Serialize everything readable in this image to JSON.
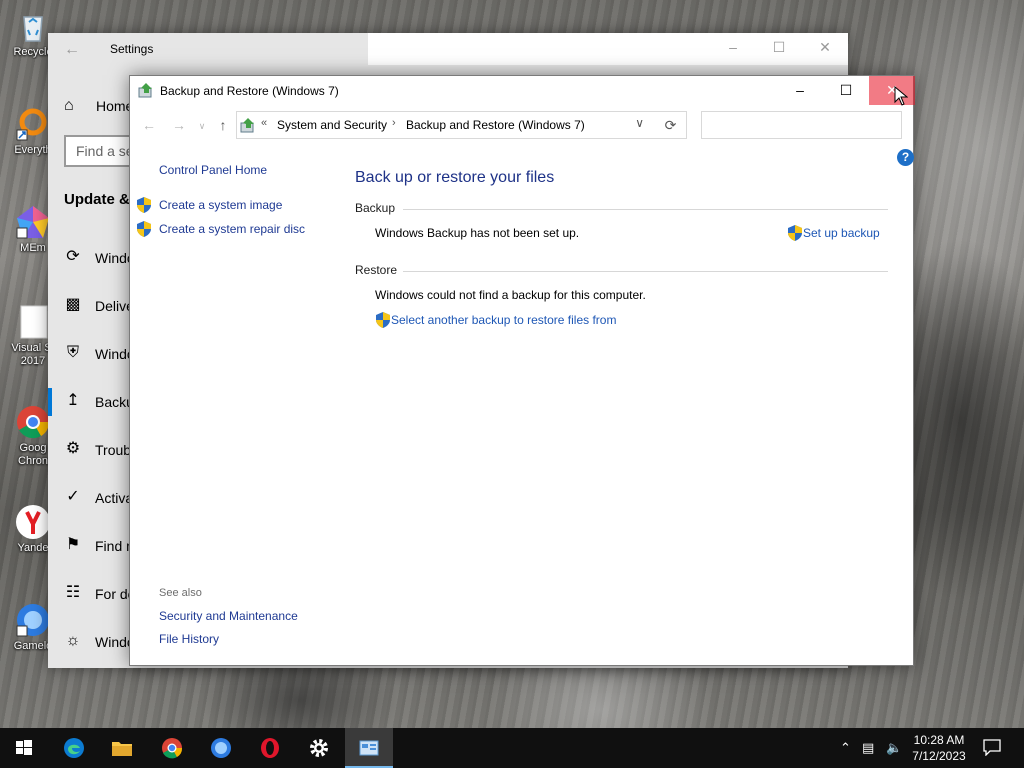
{
  "desktop": {
    "icons": [
      {
        "label": "Recycle",
        "icon": "recycle-bin-icon"
      },
      {
        "label": "Everyth",
        "icon": "everything-search-icon"
      },
      {
        "label": "MEm",
        "icon": "memu-play-icon"
      },
      {
        "label": "Visual St",
        "label2": "2017",
        "icon": "visual-studio-icon"
      },
      {
        "label": "Goog",
        "label2": "Chron",
        "icon": "google-chrome-icon"
      },
      {
        "label": "Yande",
        "icon": "yandex-browser-icon"
      },
      {
        "label": "Gamelo",
        "icon": "gameloop-icon"
      }
    ]
  },
  "settings_window": {
    "title": "Settings",
    "home_label": "Home",
    "search_placeholder": "Find a se",
    "heading": "Update &",
    "items": [
      {
        "label": "Windo",
        "icon": "sync-icon"
      },
      {
        "label": "Delive",
        "icon": "delivery-optimization-icon"
      },
      {
        "label": "Windo",
        "icon": "shield-icon"
      },
      {
        "label": "Backu",
        "icon": "backup-arrow-icon",
        "selected": true
      },
      {
        "label": "Troub",
        "icon": "wrench-icon"
      },
      {
        "label": "Activa",
        "icon": "check-circle-icon"
      },
      {
        "label": "Find m",
        "icon": "find-device-icon"
      },
      {
        "label": "For de",
        "icon": "developer-sliders-icon"
      },
      {
        "label": "Windo",
        "icon": "insider-cat-icon"
      }
    ]
  },
  "control_panel": {
    "title": "Backup and Restore (Windows 7)",
    "breadcrumb": {
      "overflow": "«",
      "items": [
        "System and Security",
        "Backup and Restore (Windows 7)"
      ]
    },
    "search_value": "",
    "left_pane": {
      "home_link": "Control Panel Home",
      "tasks": [
        "Create a system image",
        "Create a system repair disc"
      ],
      "see_also_label": "See also",
      "see_also_links": [
        "Security and Maintenance",
        "File History"
      ]
    },
    "main": {
      "title": "Back up or restore your files",
      "backup_section": {
        "label": "Backup",
        "status": "Windows Backup has not been set up.",
        "action": "Set up backup"
      },
      "restore_section": {
        "label": "Restore",
        "status": "Windows could not find a backup for this computer.",
        "action": "Select another backup to restore files from"
      }
    },
    "help_label": "?"
  },
  "taskbar": {
    "apps": [
      "start-icon",
      "edge-icon",
      "file-explorer-icon",
      "chrome-icon",
      "gameloop-icon",
      "opera-icon",
      "settings-gear-icon",
      "control-panel-icon"
    ],
    "time": "10:28 AM",
    "date": "7/12/2023"
  },
  "colors": {
    "link": "#1e57b5",
    "heading": "#1e3287",
    "accent": "#0078d7",
    "close_hover": "#e81123",
    "taskbar": "#101010"
  }
}
